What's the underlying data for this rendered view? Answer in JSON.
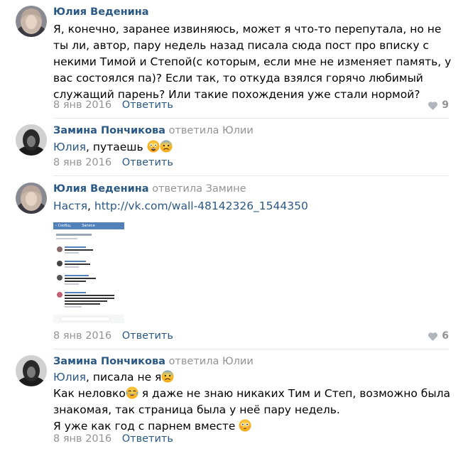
{
  "comments": [
    {
      "author": "Юлия Веденина",
      "text": "Я, конечно, заранее извиняюсь, может я что-то перепутала, но не ты ли, автор, пару недель назад писала сюда пост про вписку с некими Тимой и Степой(с которым, если мне не изменяет память, у вас состоялся па)? Если так, то откуда взялся горячо любимый служащий парень? Или такие похождения уже стали нормой?",
      "date": "8 янв 2016",
      "reply_label": "Ответить",
      "likes": "9"
    },
    {
      "author": "Замина Пончикова",
      "reply_to": "ответила Юлии",
      "mention": "Юлия",
      "text": ", путаешь",
      "date": "8 янв 2016",
      "reply_label": "Ответить"
    },
    {
      "author": "Юлия Веденина",
      "reply_to": "ответила Замине",
      "mention": "Настя",
      "text": ", ",
      "link": "http://vk.com/wall-48142326_1544350",
      "date": "8 янв 2016",
      "reply_label": "Ответить",
      "likes": "6",
      "thumbnail": {
        "header_left": "‹ Сообщ.",
        "header_right": "Записи"
      }
    },
    {
      "author": "Замина Пончикова",
      "reply_to": "ответила Юлии",
      "mention": "Юлия",
      "line1": ", писала не я",
      "line2a": "Как неловко",
      "line2b": " я даже не знаю никаких Тим и Степ, возможно была знакомая, так страница была у неё пару недель.",
      "line3": "Я уже как год с парнем вместе",
      "date": "8 янв 2016",
      "reply_label": "Ответить"
    }
  ],
  "colors": {
    "link": "#2a5885",
    "muted": "#939393",
    "divider": "#e7e8ec"
  },
  "icons": [
    "heart-icon",
    "scared-emoji",
    "fearful-emoji",
    "joy-tears-emoji",
    "flushed-emoji"
  ]
}
